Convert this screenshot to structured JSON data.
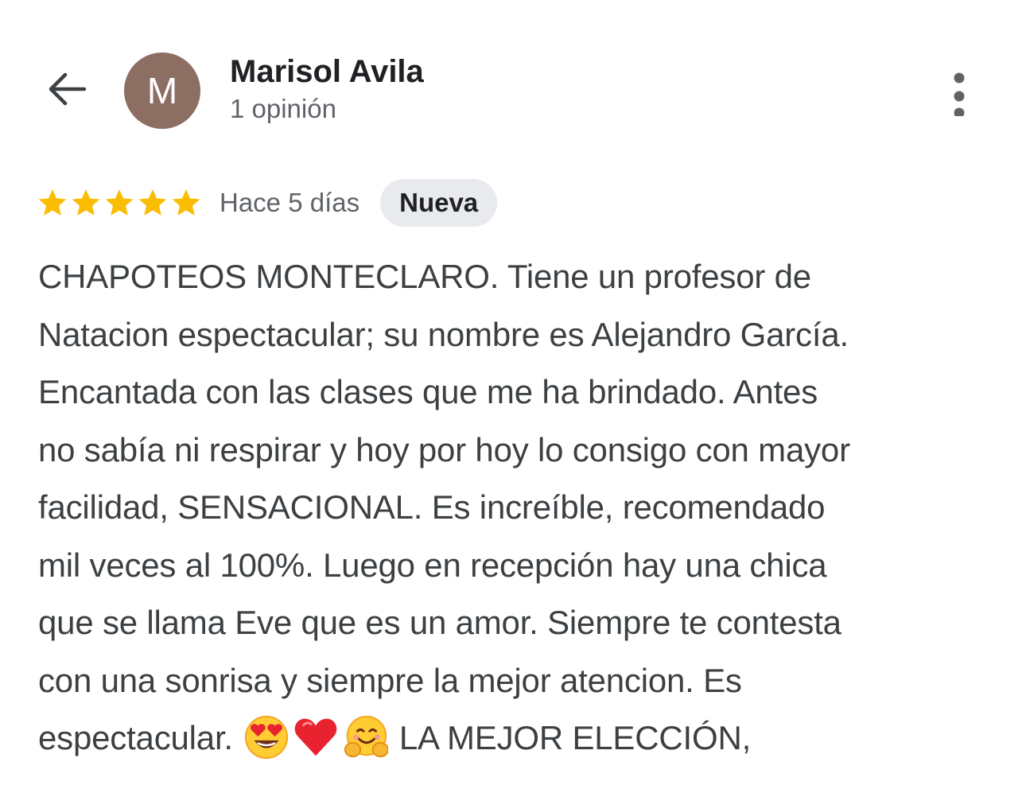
{
  "header": {
    "back_icon": "arrow-left-icon",
    "avatar_initial": "M",
    "avatar_color": "#8d6e63",
    "user_name": "Marisol Avila",
    "user_reviews_count": "1 opinión",
    "more_icon": "more-vertical-icon"
  },
  "review": {
    "rating": 5,
    "rating_max": 5,
    "star_color": "#fbbc04",
    "date": "Hace 5 días",
    "badge": "Nueva",
    "text_lines": [
      "CHAPOTEOS MONTECLARO. Tiene un profesor de",
      "Natacion espectacular; su nombre es Alejandro García.",
      "Encantada con las clases que me ha brindado. Antes",
      "no sabía ni respirar y hoy por hoy lo consigo con mayor",
      "facilidad, SENSACIONAL. Es increíble, recomendado",
      "mil veces al 100%. Luego en recepción hay una chica",
      "que se llama Eve que es un amor. Siempre te contesta",
      "con una sonrisa y siempre la mejor atencion. Es"
    ],
    "last_line_start": "espectacular.",
    "emojis": [
      "heart-eyes-emoji",
      "red-heart-emoji",
      "hugging-face-emoji"
    ],
    "last_line_end": "LA MEJOR ELECCIÓN,"
  }
}
